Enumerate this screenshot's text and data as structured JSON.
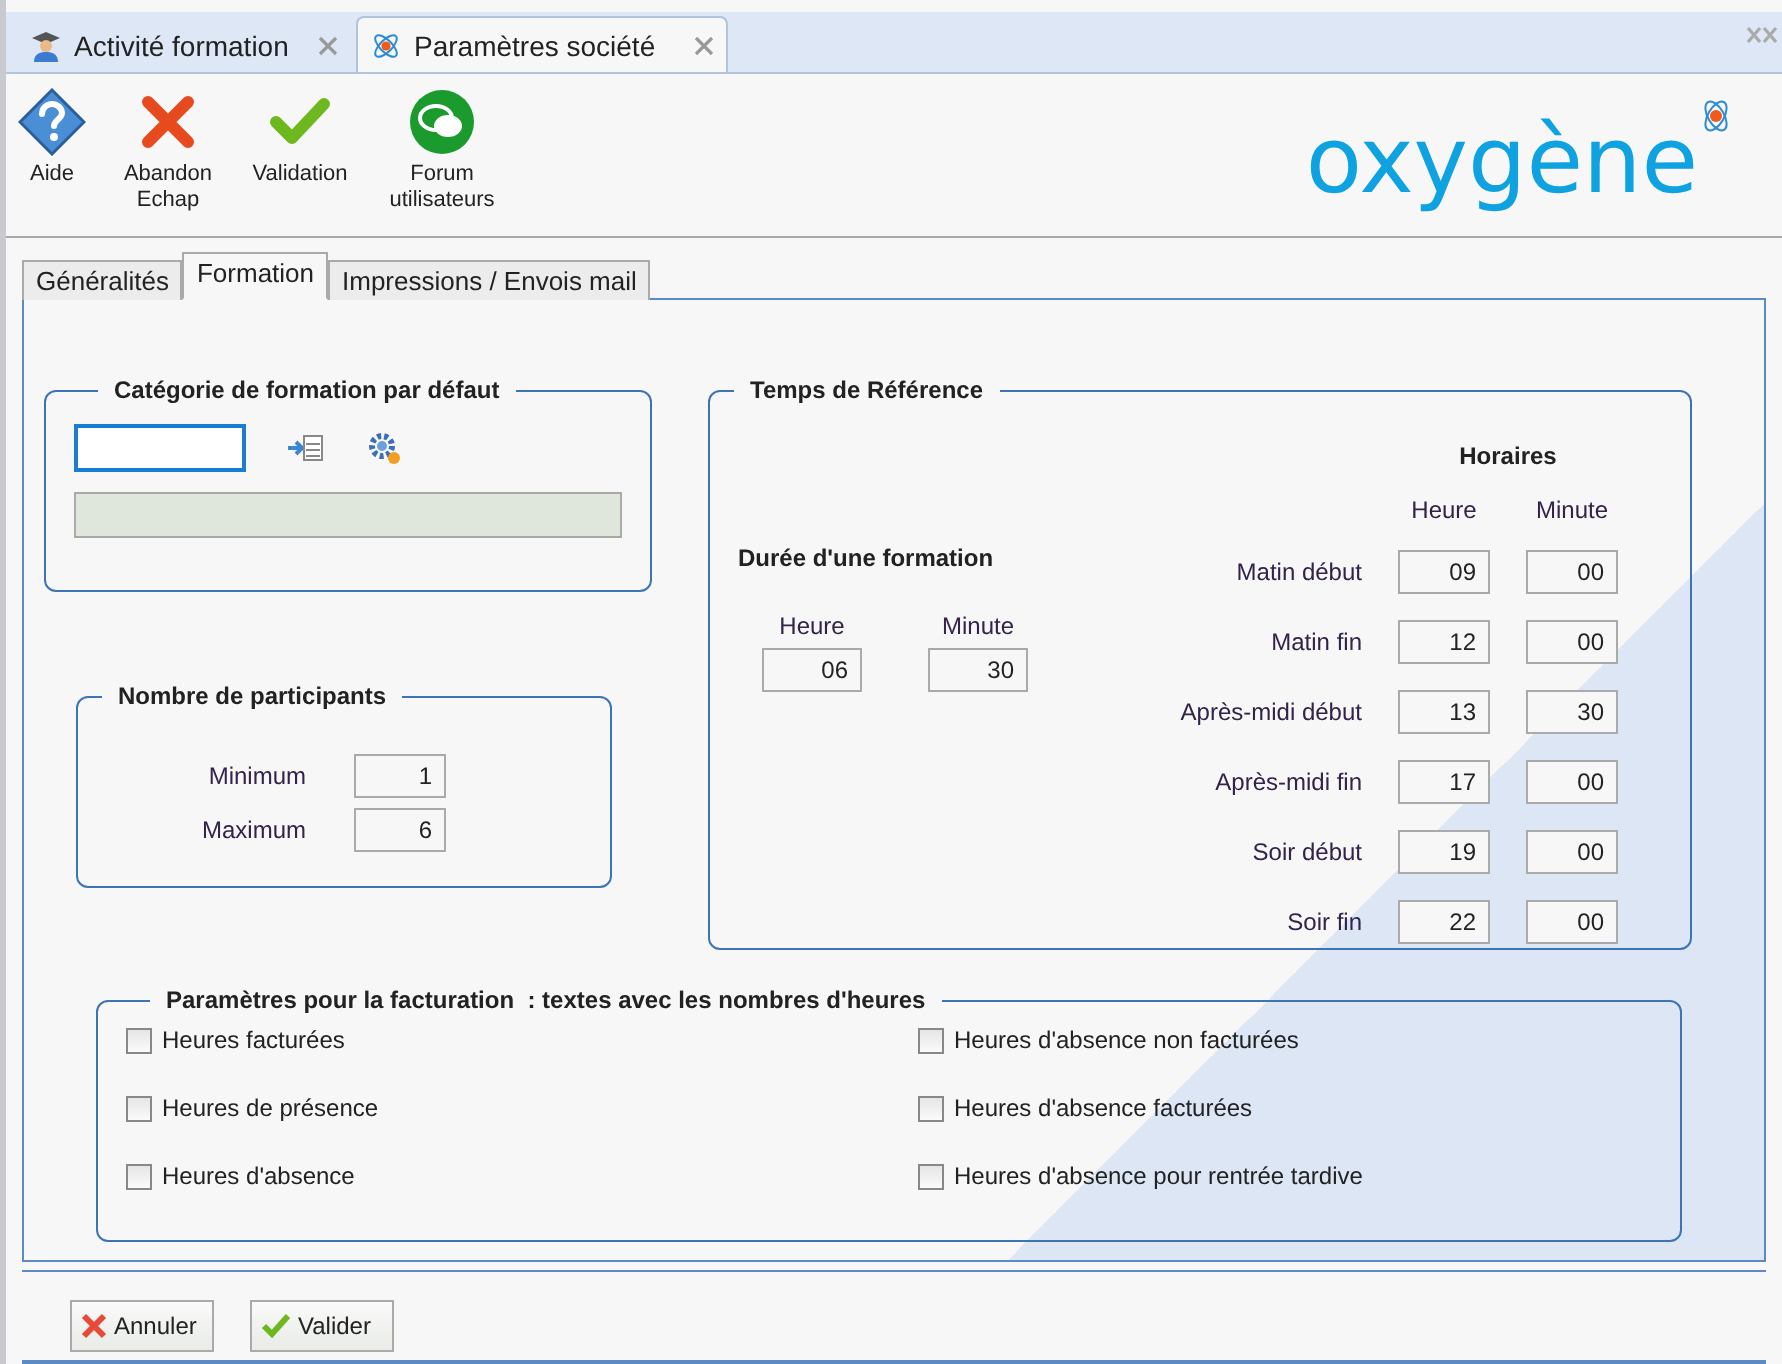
{
  "tabs": [
    {
      "label": "Activité formation",
      "selected": false,
      "kind": "training"
    },
    {
      "label": "Paramètres société",
      "selected": true,
      "kind": "settings"
    }
  ],
  "toolbar": [
    {
      "label": "Aide",
      "kind": "help"
    },
    {
      "label": "Abandon\nEchap",
      "kind": "cancel"
    },
    {
      "label": "Validation",
      "kind": "ok"
    },
    {
      "label": "Forum\nutilisateurs",
      "kind": "forum"
    }
  ],
  "logo": "oxygène",
  "subtabs": [
    {
      "label": "Généralités",
      "selected": false
    },
    {
      "label": "Formation",
      "selected": true
    },
    {
      "label": "Impressions / Envois mail",
      "selected": false
    }
  ],
  "category": {
    "title": "Catégorie de formation par défaut"
  },
  "participants": {
    "title": "Nombre de participants",
    "rows": [
      {
        "label": "Minimum",
        "value": "1"
      },
      {
        "label": "Maximum",
        "value": "6"
      }
    ]
  },
  "reference": {
    "title": "Temps de Référence",
    "duration": {
      "title": "Durée d'une formation",
      "hour_label": "Heure",
      "minute_label": "Minute",
      "hour": "06",
      "minute": "30"
    },
    "schedule": {
      "title": "Horaires",
      "hour_label": "Heure",
      "minute_label": "Minute",
      "rows": [
        {
          "label": "Matin début",
          "hour": "09",
          "minute": "00"
        },
        {
          "label": "Matin fin",
          "hour": "12",
          "minute": "00"
        },
        {
          "label": "Après-midi début",
          "hour": "13",
          "minute": "30"
        },
        {
          "label": "Après-midi fin",
          "hour": "17",
          "minute": "00"
        },
        {
          "label": "Soir début",
          "hour": "19",
          "minute": "00"
        },
        {
          "label": "Soir fin",
          "hour": "22",
          "minute": "00"
        }
      ]
    }
  },
  "billing": {
    "title": "Paramètres pour la facturation  : textes avec les nombres d'heures",
    "options": [
      {
        "label": "Heures facturées",
        "checked": false
      },
      {
        "label": "Heures d'absence non facturées",
        "checked": false
      },
      {
        "label": "Heures de présence",
        "checked": false
      },
      {
        "label": "Heures d'absence facturées",
        "checked": false
      },
      {
        "label": "Heures d'absence",
        "checked": false
      },
      {
        "label": "Heures d'absence pour rentrée tardive",
        "checked": false
      }
    ]
  },
  "footer": [
    {
      "label": "Annuler",
      "kind": "cancel"
    },
    {
      "label": "Valider",
      "kind": "ok"
    }
  ]
}
